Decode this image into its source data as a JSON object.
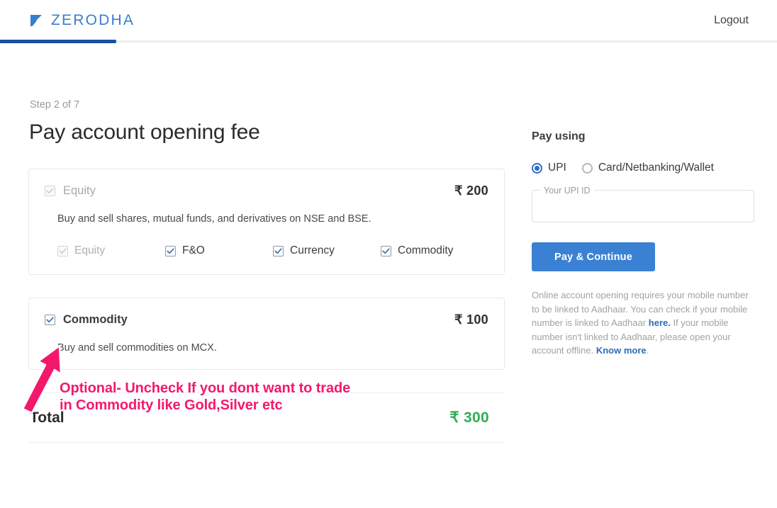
{
  "brand": {
    "name": "ZERODHA",
    "logo_icon": "zerodha-kite-logo",
    "color": "#387ed1"
  },
  "header": {
    "logout_label": "Logout",
    "progress_percent": 15,
    "progress_color": "#1c4fa1"
  },
  "main": {
    "step_label": "Step 2 of 7",
    "page_title": "Pay account opening fee",
    "plans": [
      {
        "title": "Equity",
        "price": "₹ 200",
        "checked": true,
        "disabled": true,
        "description": "Buy and sell shares, mutual funds, and derivatives on NSE and BSE.",
        "segments": [
          {
            "label": "Equity",
            "checked": true,
            "disabled": true
          },
          {
            "label": "F&O",
            "checked": true,
            "disabled": false
          },
          {
            "label": "Currency",
            "checked": true,
            "disabled": false
          },
          {
            "label": "Commodity",
            "checked": true,
            "disabled": false
          }
        ]
      },
      {
        "title": "Commodity",
        "price": "₹ 100",
        "checked": true,
        "disabled": false,
        "description": "Buy and sell commodities on MCX.",
        "segments": []
      }
    ],
    "total_label": "Total",
    "total_value": "₹ 300",
    "total_color": "#2eaf55"
  },
  "payment": {
    "title": "Pay using",
    "methods": [
      {
        "label": "UPI",
        "selected": true
      },
      {
        "label": "Card/Netbanking/Wallet",
        "selected": false
      }
    ],
    "upi_field_label": "Your UPI ID",
    "upi_field_value": "",
    "upi_field_placeholder": "",
    "submit_label": "Pay & Continue",
    "submit_color": "#3b81d3",
    "disclaimer_part1": "Online account opening requires your mobile number to be linked to Aadhaar. You can check if your mobile number is linked to Aadhaar ",
    "disclaimer_link1": "here.",
    "disclaimer_part2": " If your mobile number isn't linked to Aadhaar, please open your account offline. ",
    "disclaimer_link2": "Know more",
    "disclaimer_part3": "."
  },
  "annotation": {
    "text": "Optional- Uncheck If you dont want to trade\nin Commodity like Gold,Silver etc",
    "color": "#f4186b",
    "arrow_icon": "up-right-arrow"
  }
}
